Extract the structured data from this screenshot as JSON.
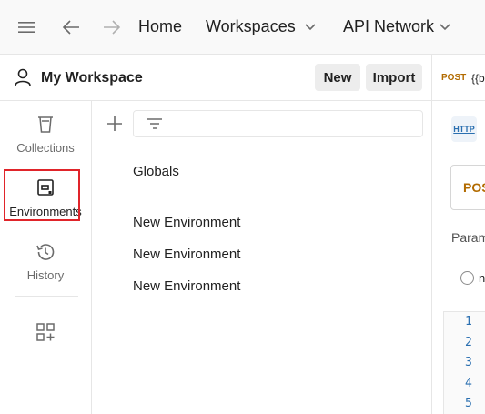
{
  "topbar": {
    "menu_icon": "hamburger-icon",
    "back_icon": "arrow-left-icon",
    "forward_icon": "arrow-right-icon",
    "home_label": "Home",
    "workspaces_label": "Workspaces",
    "api_network_label": "API Network"
  },
  "workspace": {
    "title": "My Workspace",
    "new_label": "New",
    "import_label": "Import"
  },
  "sidebar": {
    "items": [
      {
        "label": "Collections",
        "icon": "trash-can-collections-icon",
        "active": false
      },
      {
        "label": "Environments",
        "icon": "environment-icon",
        "active": true
      },
      {
        "label": "History",
        "icon": "history-icon",
        "active": false
      },
      {
        "label": "",
        "icon": "add-apps-icon",
        "active": false
      }
    ],
    "highlight_color": "#e0242a"
  },
  "list": {
    "globals_label": "Globals",
    "environments": [
      "New Environment",
      "New Environment",
      "New Environment"
    ]
  },
  "request": {
    "tab_method": "POST",
    "tab_url": "{{b",
    "http_icon_label": "HTTP",
    "method": "POS",
    "params_label": "Param",
    "radio_label": "n",
    "line_numbers": [
      "1",
      "2",
      "3",
      "4",
      "5"
    ]
  },
  "colors": {
    "accent_method": "#b26b00",
    "link_blue": "#2a6fb0"
  }
}
